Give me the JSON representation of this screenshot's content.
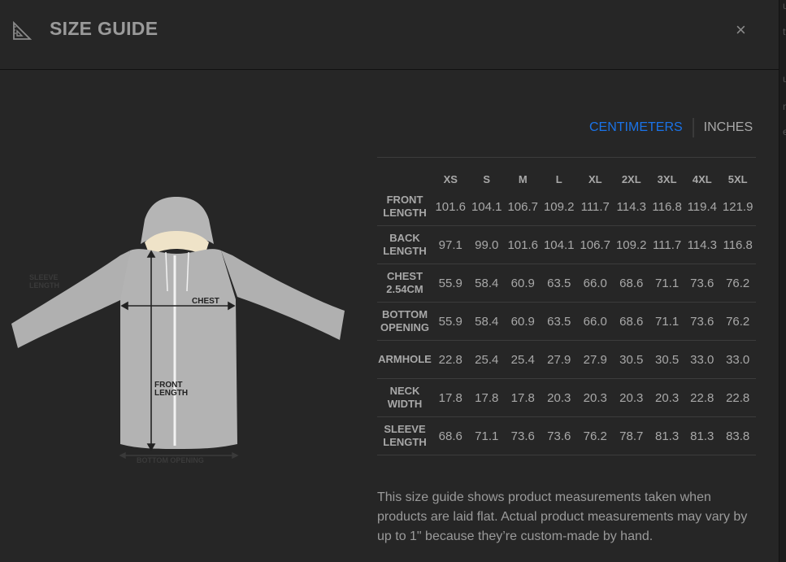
{
  "header": {
    "title": "SIZE GUIDE",
    "close_label": "×"
  },
  "units": {
    "centimeters": "CENTIMETERS",
    "inches": "INCHES",
    "selected": "CENTIMETERS"
  },
  "garment": {
    "chest_label": "CHEST",
    "front_length_label": [
      "FRONT",
      "LENGTH"
    ],
    "sleeve_length_label": [
      "SLEEVE",
      "LENGTH"
    ],
    "bottom_opening_label": "BOTTOM OPENING"
  },
  "table": {
    "sizes": [
      "XS",
      "S",
      "M",
      "L",
      "XL",
      "2XL",
      "3XL",
      "4XL",
      "5XL"
    ],
    "rows": [
      {
        "label": [
          "FRONT",
          "LENGTH"
        ],
        "values": [
          "101.6",
          "104.1",
          "106.7",
          "109.2",
          "111.7",
          "114.3",
          "116.8",
          "119.4",
          "121.9"
        ]
      },
      {
        "label": [
          "BACK",
          "LENGTH"
        ],
        "values": [
          "97.1",
          "99.0",
          "101.6",
          "104.1",
          "106.7",
          "109.2",
          "111.7",
          "114.3",
          "116.8"
        ]
      },
      {
        "label": [
          "CHEST",
          "2.54CM"
        ],
        "values": [
          "55.9",
          "58.4",
          "60.9",
          "63.5",
          "66.0",
          "68.6",
          "71.1",
          "73.6",
          "76.2"
        ]
      },
      {
        "label": [
          "BOTTOM",
          "OPENING"
        ],
        "values": [
          "55.9",
          "58.4",
          "60.9",
          "63.5",
          "66.0",
          "68.6",
          "71.1",
          "73.6",
          "76.2"
        ]
      },
      {
        "label": [
          "ARMHOLE"
        ],
        "values": [
          "22.8",
          "25.4",
          "25.4",
          "27.9",
          "27.9",
          "30.5",
          "30.5",
          "33.0",
          "33.0"
        ]
      },
      {
        "label": [
          "NECK",
          "WIDTH"
        ],
        "values": [
          "17.8",
          "17.8",
          "17.8",
          "20.3",
          "20.3",
          "20.3",
          "20.3",
          "22.8",
          "22.8"
        ]
      },
      {
        "label": [
          "SLEEVE",
          "LENGTH"
        ],
        "values": [
          "68.6",
          "71.1",
          "73.6",
          "73.6",
          "76.2",
          "78.7",
          "81.3",
          "81.3",
          "83.8"
        ]
      }
    ]
  },
  "note": "This size guide shows product measurements taken when products are laid flat. Actual product measurements may vary by up to 1\" because they’re custom-made by hand.",
  "colors": {
    "background": "#262626",
    "accent": "#1a73e8",
    "text": "#a8a8a8",
    "garment": "#b0b0b0",
    "lining": "#efe3c8"
  },
  "icons": {
    "header": "ruler-triangle-icon",
    "close": "close-icon"
  }
}
